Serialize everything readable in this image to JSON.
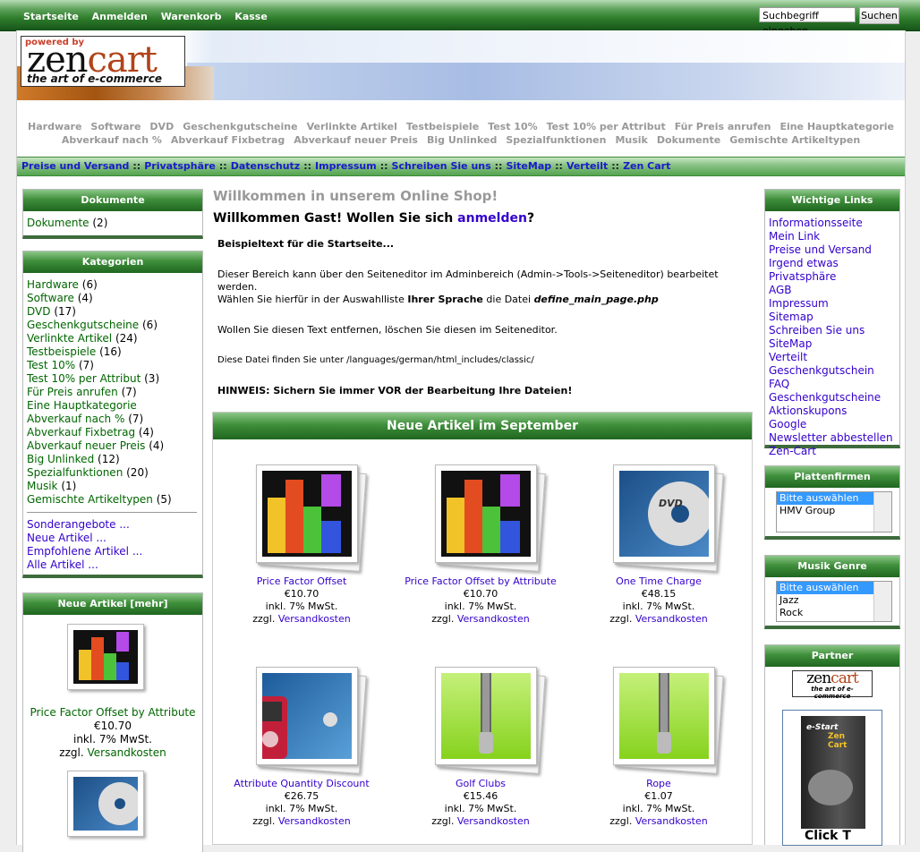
{
  "topnav": [
    "Startseite",
    "Anmelden",
    "Warenkorb",
    "Kasse"
  ],
  "search": {
    "value": "Suchbegriff eingeben",
    "button": "Suchen"
  },
  "logo": {
    "powered": "powered by",
    "name_a": "zen",
    "name_b": "cart",
    "tagline": "the art of e-commerce"
  },
  "categories_nav": {
    "row1": [
      "Hardware",
      "Software",
      "DVD",
      "Geschenkgutscheine",
      "Verlinkte Artikel",
      "Testbeispiele",
      "Test 10%",
      "Test 10% per Attribut",
      "Für Preis anrufen",
      "Eine Hauptkategorie"
    ],
    "row2": [
      "Abverkauf nach %",
      "Abverkauf Fixbetrag",
      "Abverkauf neuer Preis",
      "Big Unlinked",
      "Spezialfunktionen",
      "Musik",
      "Dokumente",
      "Gemischte Artikeltypen"
    ]
  },
  "ezpages": [
    "Preise und Versand",
    "Privatsphäre",
    "Datenschutz",
    "Impressum",
    "Schreiben Sie uns",
    "SiteMap",
    "Verteilt",
    "Zen Cart"
  ],
  "ezsep": "::",
  "left": {
    "documents": {
      "title": "Dokumente",
      "item": "Dokumente",
      "count": "(2)"
    },
    "categories": {
      "title": "Kategorien",
      "items": [
        {
          "label": "Hardware",
          "count": "(6)"
        },
        {
          "label": "Software",
          "count": "(4)"
        },
        {
          "label": "DVD",
          "count": "(17)"
        },
        {
          "label": "Geschenkgutscheine",
          "count": "(6)"
        },
        {
          "label": "Verlinkte Artikel",
          "count": "(24)"
        },
        {
          "label": "Testbeispiele",
          "count": "(16)"
        },
        {
          "label": "Test 10%",
          "count": "(7)"
        },
        {
          "label": "Test 10% per Attribut",
          "count": "(3)"
        },
        {
          "label": "Für Preis anrufen",
          "count": "(7)"
        },
        {
          "label": "Eine Hauptkategorie",
          "count": ""
        },
        {
          "label": "Abverkauf nach %",
          "count": "(7)"
        },
        {
          "label": "Abverkauf Fixbetrag",
          "count": "(4)"
        },
        {
          "label": "Abverkauf neuer Preis",
          "count": "(4)"
        },
        {
          "label": "Big Unlinked",
          "count": "(12)"
        },
        {
          "label": "Spezialfunktionen",
          "count": "(20)"
        },
        {
          "label": "Musik",
          "count": "(1)"
        },
        {
          "label": "Gemischte Artikeltypen",
          "count": "(5)"
        }
      ],
      "links": [
        "Sonderangebote ...",
        "Neue Artikel ...",
        "Empfohlene Artikel ...",
        "Alle Artikel ..."
      ]
    },
    "new_products": {
      "title": "Neue Artikel [mehr]",
      "name": "Price Factor Offset by Attribute",
      "price": "€10.70",
      "tax": "inkl. 7% MwSt.",
      "ship_prefix": "zzgl.",
      "ship_link": "Versandkosten"
    }
  },
  "center": {
    "greeting_title": "Willkommen in unserem Online Shop!",
    "greeting_text": "Willkommen Gast! Wollen Sie sich",
    "greeting_link": "anmelden",
    "greeting_end": "?",
    "p1": "Beispieltext für die Startseite...",
    "p2": "Dieser Bereich kann über den Seiteneditor im Adminbereich (Admin->Tools->Seiteneditor) bearbeitet werden.",
    "p3a": "Wählen Sie hierfür in der Auswahlliste",
    "p3b": "Ihrer Sprache",
    "p3c": "die Datei",
    "p3d": "define_main_page.php",
    "p4": "Wollen Sie diesen Text entfernen, löschen Sie diesen im Seiteneditor.",
    "p5": "Diese Datei finden Sie unter /languages/german/html_includes/classic/",
    "p6": "HINWEIS: Sichern Sie immer VOR der Bearbeitung Ihre Dateien!",
    "new_title": "Neue Artikel im September",
    "products": [
      {
        "name": "Price Factor Offset",
        "price": "€10.70",
        "tax": "inkl. 7% MwSt.",
        "ship_prefix": "zzgl.",
        "ship_link": "Versandkosten",
        "image": "bars-chart"
      },
      {
        "name": "Price Factor Offset by Attribute",
        "price": "€10.70",
        "tax": "inkl. 7% MwSt.",
        "ship_prefix": "zzgl.",
        "ship_link": "Versandkosten",
        "image": "bars-chart"
      },
      {
        "name": "One Time Charge",
        "price": "€48.15",
        "tax": "inkl. 7% MwSt.",
        "ship_prefix": "zzgl.",
        "ship_link": "Versandkosten",
        "image": "dvd"
      },
      {
        "name": "Attribute Quantity Discount",
        "price": "€26.75",
        "tax": "inkl. 7% MwSt.",
        "ship_prefix": "zzgl.",
        "ship_link": "Versandkosten",
        "image": "ipod"
      },
      {
        "name": "Golf Clubs",
        "price": "€15.46",
        "tax": "inkl. 7% MwSt.",
        "ship_prefix": "zzgl.",
        "ship_link": "Versandkosten",
        "image": "zip"
      },
      {
        "name": "Rope",
        "price": "€1.07",
        "tax": "inkl. 7% MwSt.",
        "ship_prefix": "zzgl.",
        "ship_link": "Versandkosten",
        "image": "zip"
      }
    ]
  },
  "right": {
    "links": {
      "title": "Wichtige Links",
      "items": [
        "Informationsseite",
        "Mein Link",
        "Preise und Versand",
        "Irgend etwas",
        "Privatsphäre",
        "AGB",
        "Impressum",
        "Sitemap",
        "Schreiben Sie uns",
        "SiteMap",
        "Verteilt",
        "Geschenkgutschein FAQ",
        "Geschenkgutscheine",
        "Aktionskupons",
        "Google",
        "Newsletter abbestellen",
        "Zen-Cart"
      ]
    },
    "labels": {
      "title": "Plattenfirmen",
      "options": [
        "Bitte auswählen",
        "HMV Group"
      ]
    },
    "genre": {
      "title": "Musik Genre",
      "options": [
        "Bitte auswählen",
        "Jazz",
        "Rock"
      ]
    },
    "partner": {
      "title": "Partner",
      "logo_a": "zen",
      "logo_b": "cart",
      "logo_tag": "the art of e-commerce",
      "box_title": "e-Start",
      "box_sub": "Zen Cart",
      "box_bottom": "Click T"
    }
  }
}
